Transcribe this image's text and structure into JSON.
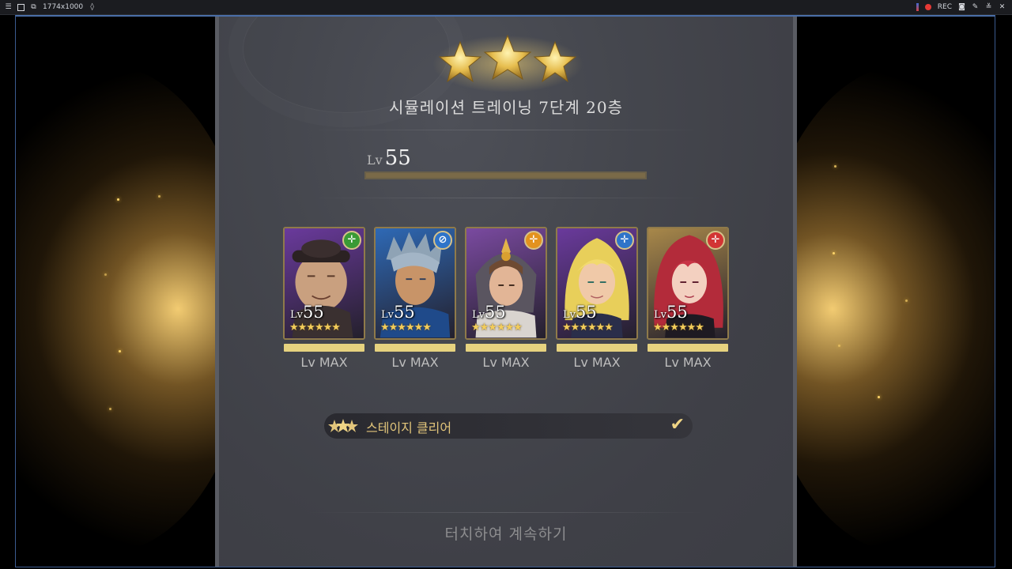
{
  "recorder": {
    "resolution": "1774x1000",
    "rec_label": "REC"
  },
  "stage": {
    "stars_earned": 3,
    "title": "시뮬레이션 트레이닝 7단계 20층"
  },
  "account_level": {
    "prefix": "Lv",
    "value": "55",
    "exp_fraction": 1.0
  },
  "heroes": [
    {
      "lv_prefix": "Lv",
      "level": "55",
      "stars": "★★★★★★",
      "max_label": "Lv MAX",
      "class_color": "#3a9a35",
      "card_color": "#6a3a9c",
      "portrait": "old-man-hat"
    },
    {
      "lv_prefix": "Lv",
      "level": "55",
      "stars": "★★★★★★",
      "max_label": "Lv MAX",
      "class_color": "#2f74c9",
      "card_color": "#2e69b5",
      "portrait": "spiky-grey-hair-man"
    },
    {
      "lv_prefix": "Lv",
      "level": "55",
      "stars": "★★★★★★",
      "max_label": "Lv MAX",
      "class_color": "#e3921e",
      "card_color": "#7a4aa0",
      "portrait": "armored-woman"
    },
    {
      "lv_prefix": "Lv",
      "level": "55",
      "stars": "★★★★★★",
      "max_label": "Lv MAX",
      "class_color": "#2f74c9",
      "card_color": "#6a3a9c",
      "portrait": "blonde-woman"
    },
    {
      "lv_prefix": "Lv",
      "level": "55",
      "stars": "★★★★★★",
      "max_label": "Lv MAX",
      "class_color": "#d23434",
      "card_color": "#a8884a",
      "portrait": "red-hair-woman"
    }
  ],
  "objective": {
    "label": "스테이지 클리어",
    "completed": true
  },
  "continue_prompt": "터치하여 계속하기",
  "colors": {
    "panel": "#45474e",
    "gold": "#e3c67b",
    "glow": "#ffd56a"
  }
}
